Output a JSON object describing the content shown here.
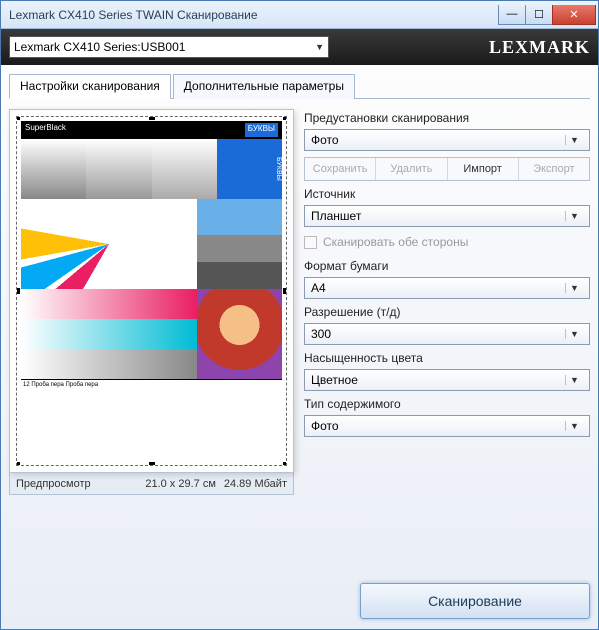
{
  "window": {
    "title": "Lexmark CX410 Series TWAIN Сканирование"
  },
  "blackbar": {
    "device": "Lexmark CX410 Series:USB001",
    "brand": "LEXMARK"
  },
  "tabs": {
    "scan_settings": "Настройки сканирования",
    "advanced": "Дополнительные параметры"
  },
  "preview": {
    "label": "Предпросмотр",
    "dimensions": "21.0 x 29.7 см",
    "size": "24.89 Мбайт",
    "testpage_text1": "SuperBlack",
    "testpage_text2": "БУКВЫ",
    "testpage_footer": "12 Проба пера Проба пера"
  },
  "settings": {
    "preset_label": "Предустановки сканирования",
    "preset_value": "Фото",
    "btn_save": "Сохранить",
    "btn_delete": "Удалить",
    "btn_import": "Импорт",
    "btn_export": "Экспорт",
    "source_label": "Источник",
    "source_value": "Планшет",
    "duplex_label": "Сканировать обе стороны",
    "paper_label": "Формат бумаги",
    "paper_value": "A4",
    "dpi_label": "Разрешение (т/д)",
    "dpi_value": "300",
    "color_label": "Насыщенность цвета",
    "color_value": "Цветное",
    "content_label": "Тип содержимого",
    "content_value": "Фото"
  },
  "scan_button": "Сканирование"
}
